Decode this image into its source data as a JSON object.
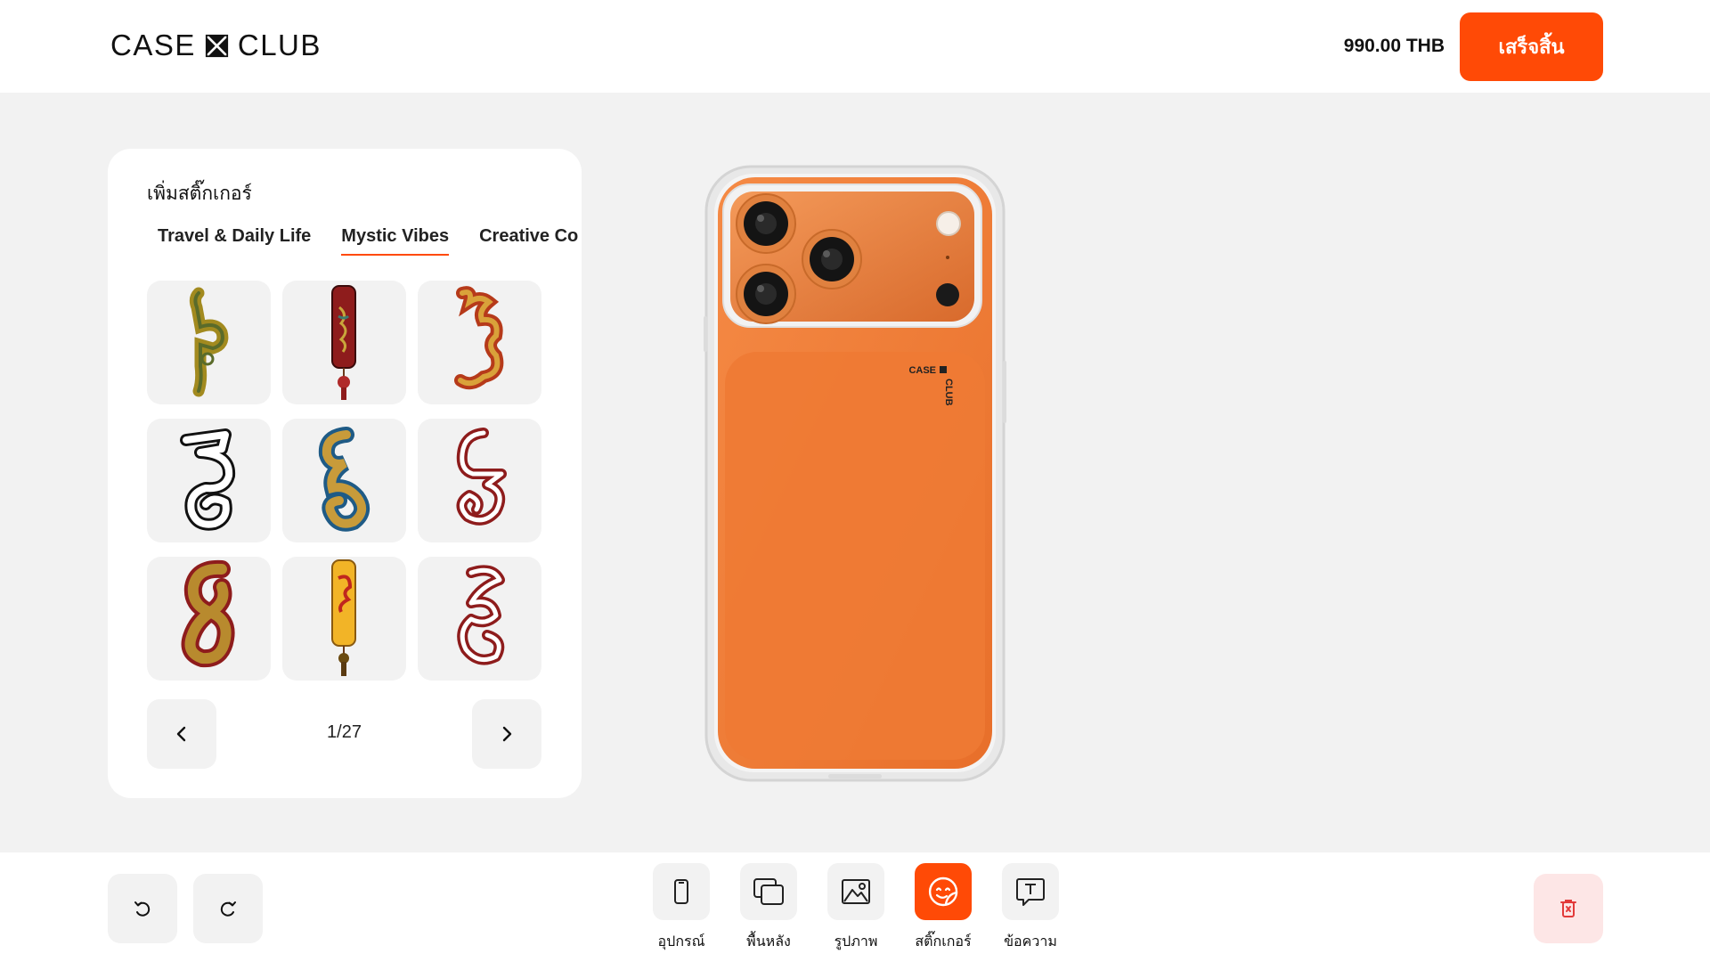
{
  "header": {
    "logo_left": "CASE",
    "logo_right": "CLUB",
    "price": "990.00 THB",
    "finish_label": "เสร็จสิ้น"
  },
  "sticker_panel": {
    "title": "เพิ่มสติ๊กเกอร์",
    "tabs": [
      {
        "label": "Travel & Daily Life",
        "active": false
      },
      {
        "label": "Mystic Vibes",
        "active": true
      },
      {
        "label": "Creative Co",
        "active": false
      }
    ],
    "stickers": [
      {
        "icon": "thai-numeral-gold-sticker"
      },
      {
        "icon": "red-talisman-tassel-sticker"
      },
      {
        "icon": "thai-script-red-gold-sticker"
      },
      {
        "icon": "thai-numeral-outline-sticker"
      },
      {
        "icon": "thai-numeral-blue-gold-sticker"
      },
      {
        "icon": "thai-numeral-dark-red-sticker"
      },
      {
        "icon": "thai-numeral-gold-red-sticker"
      },
      {
        "icon": "yellow-talisman-tassel-sticker"
      },
      {
        "icon": "thai-script-red-outline-sticker"
      }
    ],
    "page_indicator": "1/27"
  },
  "phone": {
    "case_color": "#f07f3c",
    "brand_text_top": "CASE",
    "brand_text_side": "CLUB"
  },
  "toolbar": {
    "tools": [
      {
        "label": "อุปกรณ์",
        "icon": "phone-device-icon",
        "active": false
      },
      {
        "label": "พื้นหลัง",
        "icon": "background-layers-icon",
        "active": false
      },
      {
        "label": "รูปภาพ",
        "icon": "image-icon",
        "active": false
      },
      {
        "label": "สติ๊กเกอร์",
        "icon": "sticker-icon",
        "active": true
      },
      {
        "label": "ข้อความ",
        "icon": "text-icon",
        "active": false
      }
    ]
  },
  "colors": {
    "accent": "#ff4a06",
    "panel_bg": "#ffffff",
    "page_bg": "#f2f2f2",
    "delete_bg": "#fde6e6"
  }
}
